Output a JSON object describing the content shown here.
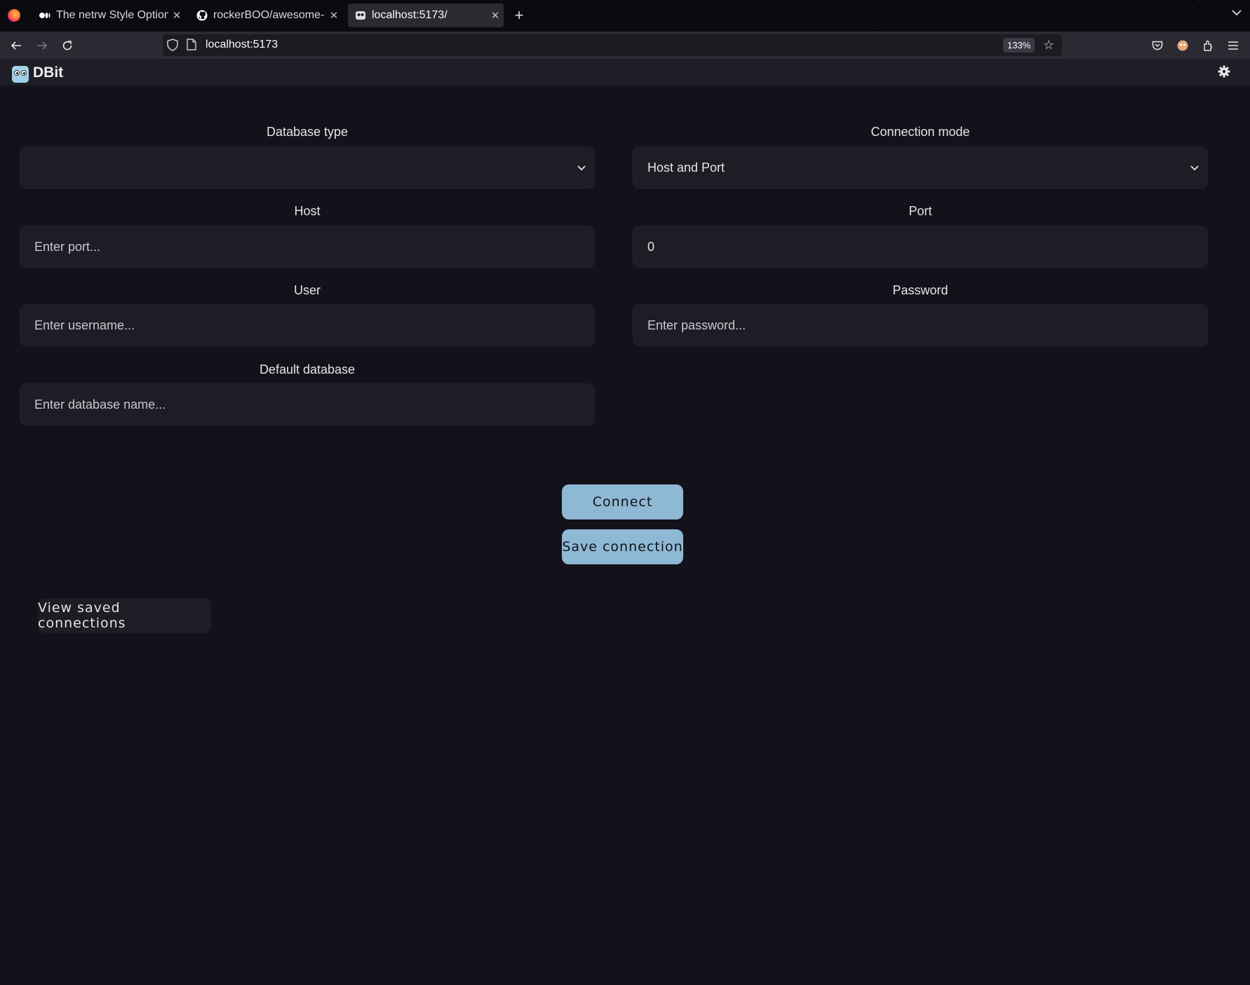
{
  "browser": {
    "tabs": [
      {
        "title": "The netrw Style Option",
        "favicon": "medium-icon",
        "active": false
      },
      {
        "title": "rockerBOO/awesome-",
        "favicon": "github-icon",
        "active": false
      },
      {
        "title": "localhost:5173/",
        "favicon": "dbit-favicon",
        "active": true
      }
    ],
    "url": "localhost:5173",
    "zoom": "133%"
  },
  "app": {
    "title": "DBit"
  },
  "form": {
    "database_type": {
      "label": "Database type",
      "value": ""
    },
    "connection_mode": {
      "label": "Connection mode",
      "value": "Host and Port"
    },
    "host": {
      "label": "Host",
      "placeholder": "Enter port..."
    },
    "port": {
      "label": "Port",
      "value": "0"
    },
    "user": {
      "label": "User",
      "placeholder": "Enter username..."
    },
    "password": {
      "label": "Password",
      "placeholder": "Enter password..."
    },
    "default_database": {
      "label": "Default database",
      "placeholder": "Enter database name..."
    }
  },
  "actions": {
    "connect_label": "Connect",
    "save_label": "Save connection",
    "view_saved_label": "View saved connections"
  },
  "colors": {
    "background": "#13111a",
    "field_bg": "#1e1c24",
    "accent_button": "#8fb8d4"
  }
}
